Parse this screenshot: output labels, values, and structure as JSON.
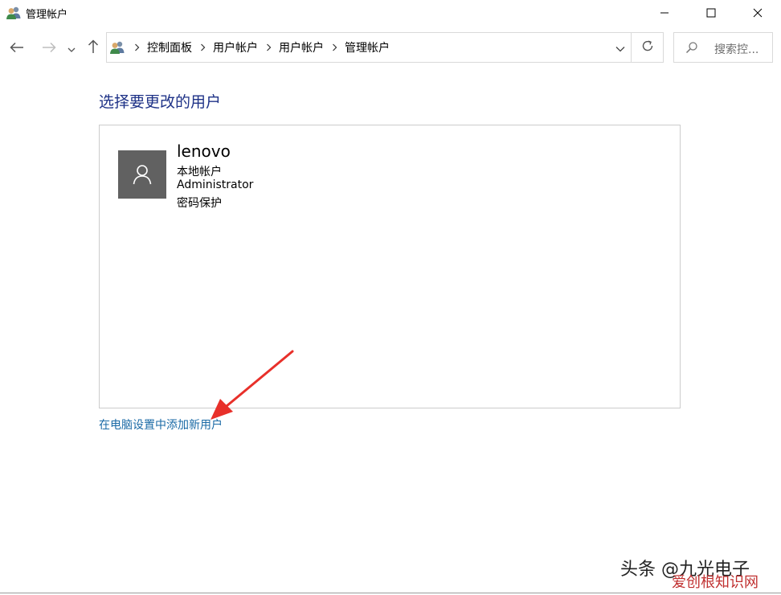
{
  "window": {
    "title": "管理帐户",
    "icon": "users-icon"
  },
  "nav": {
    "back_icon": "arrow-left-icon",
    "forward_icon": "arrow-right-icon",
    "recent_icon": "chevron-down-icon",
    "up_icon": "arrow-up-icon"
  },
  "address": {
    "crumbs": [
      "控制面板",
      "用户帐户",
      "用户帐户",
      "管理帐户"
    ]
  },
  "search": {
    "placeholder": "搜索控..."
  },
  "main": {
    "heading": "选择要更改的用户",
    "user": {
      "name": "lenovo",
      "type": "本地帐户",
      "role": "Administrator",
      "status": "密码保护"
    },
    "add_user_link": "在电脑设置中添加新用户"
  },
  "colors": {
    "heading": "#1e3287",
    "link": "#1a6aa6",
    "avatar_bg": "#616161",
    "arrow": "#e8302a"
  },
  "watermark": {
    "line1": "头条 @九光电子",
    "line2": "爱创根知识网"
  }
}
